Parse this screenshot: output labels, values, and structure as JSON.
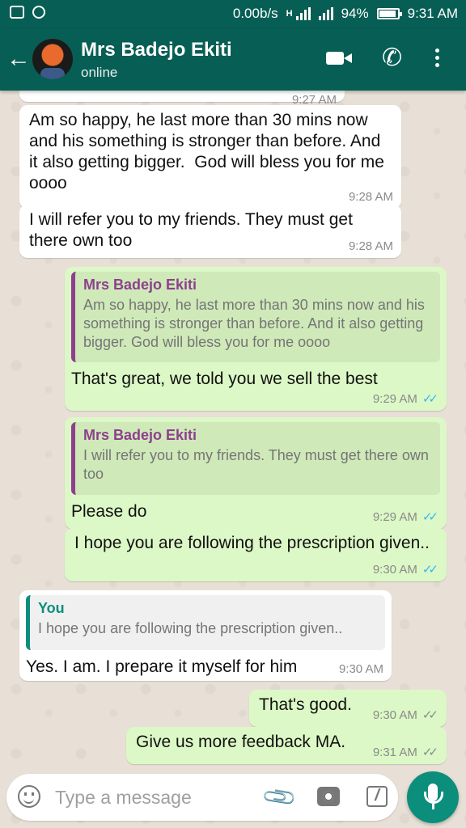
{
  "status_bar": {
    "network_speed": "0.00b/s",
    "network_type": "H",
    "battery": "94%",
    "time": "9:31 AM"
  },
  "header": {
    "contact_name": "Mrs Badejo Ekiti",
    "status": "online"
  },
  "messages": [
    {
      "direction": "in",
      "text": "",
      "time": "9:27 AM"
    },
    {
      "direction": "in",
      "text": "Am so happy, he last more than 30 mins now and his something is stronger than before. And it also getting bigger.  God will bless you for me oooo",
      "time": "9:28 AM"
    },
    {
      "direction": "in",
      "text": "I will refer you to my friends. They must get there own too",
      "time": "9:28 AM"
    },
    {
      "direction": "out",
      "quote_author": "Mrs Badejo Ekiti",
      "quote_text": "Am so happy, he last more than 30 mins now and his something is stronger than before. And it also getting bigger.  God will bless you for me oooo",
      "text": "That's great, we told you we sell the best",
      "time": "9:29 AM",
      "read": true
    },
    {
      "direction": "out",
      "quote_author": "Mrs Badejo Ekiti",
      "quote_text": "I will refer you to my friends. They must get there own too",
      "text": "Please do",
      "time": "9:29 AM",
      "read": true
    },
    {
      "direction": "out",
      "text": "I hope you are following the prescription given..",
      "time": "9:30 AM",
      "read": true
    },
    {
      "direction": "in",
      "quote_author": "You",
      "quote_text": "I hope you are following the prescription given..",
      "text": "Yes. I am. I prepare it myself for him",
      "time": "9:30 AM"
    },
    {
      "direction": "out",
      "text": "That's good.",
      "time": "9:30 AM",
      "read": false
    },
    {
      "direction": "out",
      "text": "Give us more feedback MA.",
      "time": "9:31 AM",
      "read": false
    }
  ],
  "composer": {
    "placeholder": "Type a message"
  },
  "icons": {
    "back": "back-arrow-icon",
    "video": "video-call-icon",
    "call": "phone-icon",
    "menu": "more-vert-icon",
    "emoji": "emoji-icon",
    "attach": "paperclip-icon",
    "camera": "camera-icon",
    "pencil": "pencil-icon",
    "mic": "mic-icon"
  },
  "colors": {
    "header": "#075e54",
    "incoming_bubble": "#ffffff",
    "outgoing_bubble": "#dcf8c6",
    "accent": "#0b8e7c",
    "read_ticks": "#34b7f1",
    "quote_author_out": "#8e3f8e"
  }
}
